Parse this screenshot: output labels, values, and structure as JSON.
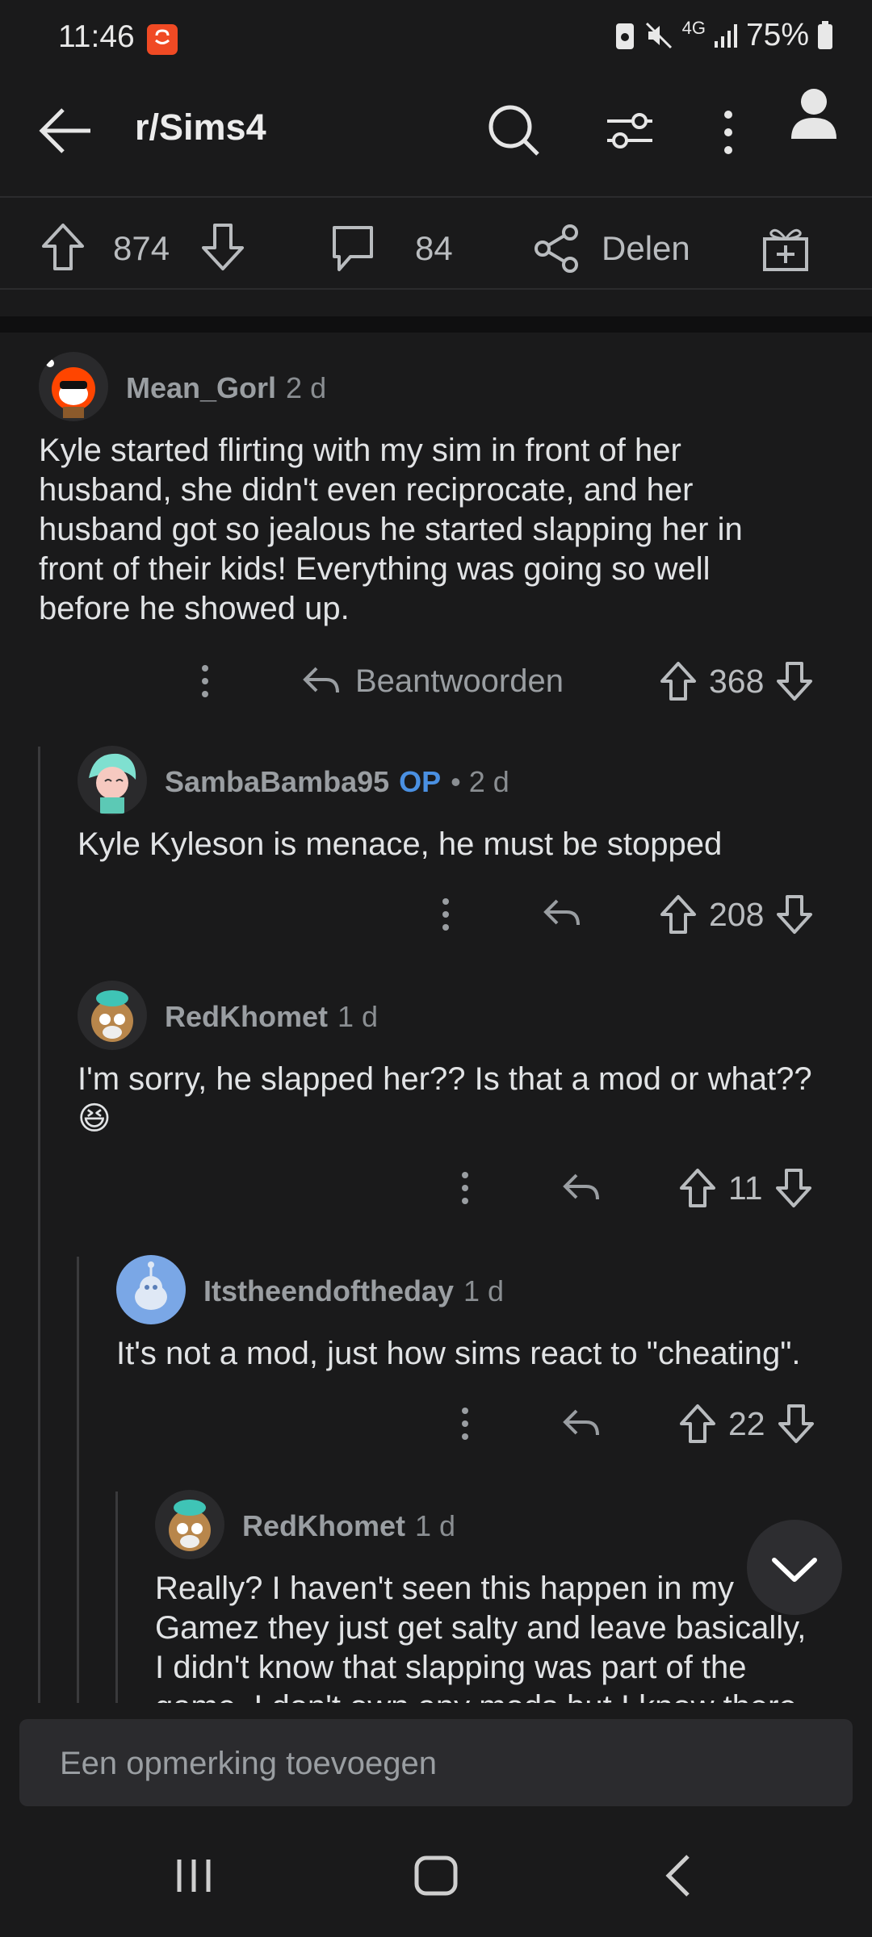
{
  "status": {
    "time": "11:46",
    "network": "4G",
    "battery": "75%"
  },
  "header": {
    "title": "r/Sims4"
  },
  "post_actions": {
    "upvotes": "874",
    "comments": "84",
    "share_label": "Delen"
  },
  "comments": [
    {
      "username": "Mean_Gorl",
      "age": "2 d",
      "lines": [
        "Kyle started flirting with my sim in front of her",
        "husband, she didn't even reciprocate, and her",
        "husband got so jealous he started slapping her in",
        "front of their kids! Everything was going so well",
        "before he showed up."
      ],
      "reply_label": "Beantwoorden",
      "votes": "368"
    },
    {
      "username": "SambaBamba95",
      "op_badge": "OP",
      "age": "• 2 d",
      "lines": [
        "Kyle Kyleson is menace, he must be stopped"
      ],
      "votes": "208"
    },
    {
      "username": "RedKhomet",
      "age": "1 d",
      "lines": [
        "I'm sorry, he slapped her?? Is that a mod or what??"
      ],
      "emoji": "😆",
      "votes": "11"
    },
    {
      "username": "Itstheendoftheday",
      "age": "1 d",
      "lines": [
        "It's not a mod, just how sims react to \"cheating\"."
      ],
      "votes": "22"
    },
    {
      "username": "RedKhomet",
      "age": "1 d",
      "lines": [
        "Really? I haven't seen this happen in my",
        "Gamez they just get salty and leave basically,",
        "I didn't know that slapping was part of the",
        "game. I don't own any mods but I know there"
      ]
    }
  ],
  "composer": {
    "placeholder": "Een opmerking toevoegen"
  }
}
